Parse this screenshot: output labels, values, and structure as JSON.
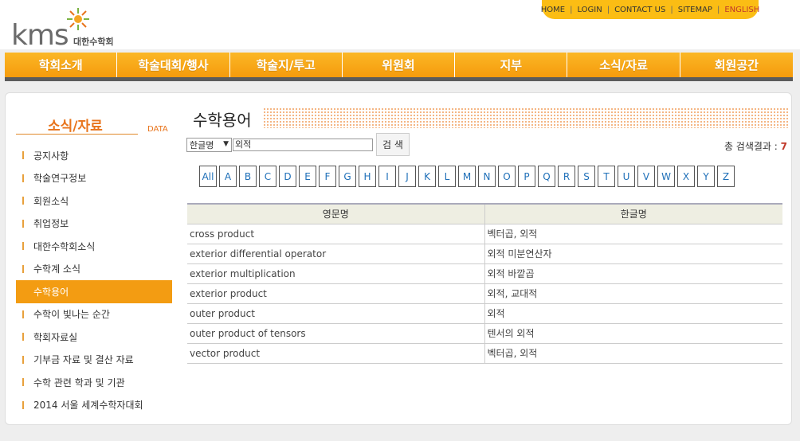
{
  "logo": {
    "text": "kms",
    "kor": "대한수학회"
  },
  "util_nav": [
    {
      "label": "HOME"
    },
    {
      "label": "LOGIN"
    },
    {
      "label": "CONTACT US"
    },
    {
      "label": "SITEMAP"
    },
    {
      "label": "ENGLISH"
    }
  ],
  "gnb": [
    "학회소개",
    "학술대회/행사",
    "학술지/투고",
    "위원회",
    "지부",
    "소식/자료",
    "회원공간"
  ],
  "sidebar": {
    "title": "소식/자료",
    "subtitle": "DATA",
    "items": [
      "공지사항",
      "학술연구정보",
      "회원소식",
      "취업정보",
      "대한수학회소식",
      "수학계 소식",
      "수학용어",
      "수학이 빛나는 순간",
      "학회자료실",
      "기부금 자료 및 결산 자료",
      "수학 관련 학과 및 기관",
      "2014 서울 세계수학자대회"
    ],
    "active_index": 6
  },
  "main": {
    "title": "수학용어",
    "search": {
      "select_value": "한글명",
      "input_value": "외적",
      "button_label": "검 색",
      "result_label": "총 검색결과 : ",
      "result_count": "7"
    },
    "alphabet": [
      "All",
      "A",
      "B",
      "C",
      "D",
      "E",
      "F",
      "G",
      "H",
      "I",
      "J",
      "K",
      "L",
      "M",
      "N",
      "O",
      "P",
      "Q",
      "R",
      "S",
      "T",
      "U",
      "V",
      "W",
      "X",
      "Y",
      "Z"
    ],
    "table": {
      "headers": [
        "영문명",
        "한글명"
      ],
      "rows": [
        [
          "cross product",
          "벡터곱, 외적"
        ],
        [
          "exterior differential operator",
          "외적 미분연산자"
        ],
        [
          "exterior multiplication",
          "외적 바깥곱"
        ],
        [
          "exterior product",
          "외적, 교대적"
        ],
        [
          "outer product",
          "외적"
        ],
        [
          "outer product of tensors",
          "텐서의 외적"
        ],
        [
          "vector product",
          "벡터곱, 외적"
        ]
      ]
    }
  }
}
